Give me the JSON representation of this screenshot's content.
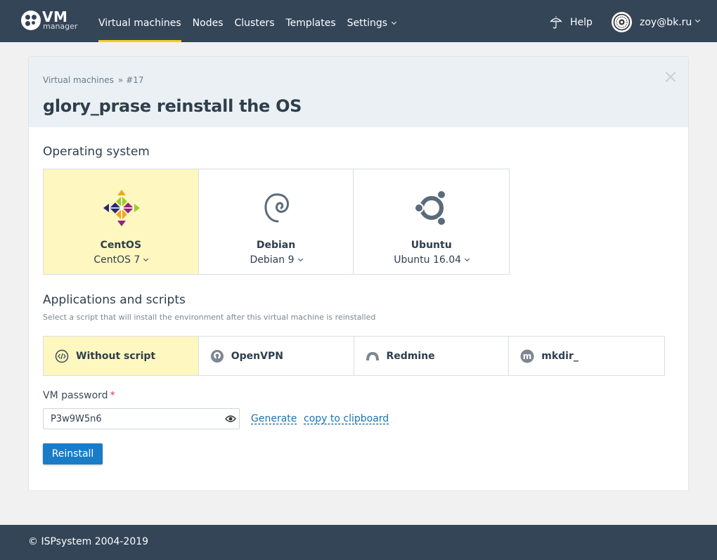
{
  "app": {
    "logo_text": "VM",
    "logo_subtext": "manager"
  },
  "nav": {
    "items": [
      {
        "label": "Virtual machines",
        "active": true
      },
      {
        "label": "Nodes"
      },
      {
        "label": "Clusters"
      },
      {
        "label": "Templates"
      },
      {
        "label": "Settings",
        "has_dropdown": true
      }
    ],
    "help_label": "Help",
    "user_email": "zoy@bk.ru"
  },
  "page": {
    "breadcrumb": [
      "Virtual machines",
      "#17"
    ],
    "breadcrumb_separator": "»",
    "title": "glory_prase reinstall the OS"
  },
  "os_section": {
    "title": "Operating system",
    "options": [
      {
        "name": "CentOS",
        "version": "CentOS 7",
        "icon": "centos-icon",
        "selected": true
      },
      {
        "name": "Debian",
        "version": "Debian 9",
        "icon": "debian-icon",
        "selected": false
      },
      {
        "name": "Ubuntu",
        "version": "Ubuntu 16.04",
        "icon": "ubuntu-icon",
        "selected": false
      }
    ]
  },
  "scripts_section": {
    "title": "Applications and scripts",
    "hint": "Select a script that will install the environment after this virtual machine is reinstalled",
    "options": [
      {
        "label": "Without script",
        "icon": "no-script-icon",
        "selected": true
      },
      {
        "label": "OpenVPN",
        "icon": "openvpn-icon",
        "selected": false
      },
      {
        "label": "Redmine",
        "icon": "redmine-icon",
        "selected": false
      },
      {
        "label": "mkdir_",
        "icon": "script-m-icon",
        "selected": false
      }
    ]
  },
  "password": {
    "label": "VM password",
    "required_mark": "*",
    "value": "P3w9W5n6",
    "generate_label": "Generate",
    "copy_label": "copy to clipboard"
  },
  "actions": {
    "reinstall_label": "Reinstall"
  },
  "footer": {
    "copyright": "© ISPsystem 2004-2019"
  },
  "colors": {
    "header_bg": "#344558",
    "nav_active_underline": "#f3cf1b",
    "selected_tile_bg": "#fef7bf",
    "primary_button": "#1a7cc7",
    "link": "#1a73b5"
  }
}
